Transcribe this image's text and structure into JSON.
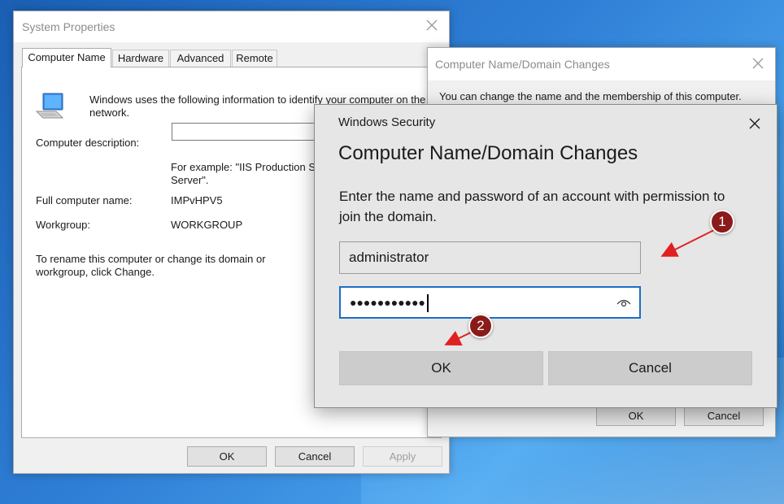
{
  "system_properties": {
    "title": "System Properties",
    "tabs": [
      "Computer Name",
      "Hardware",
      "Advanced",
      "Remote"
    ],
    "active_tab": "Computer Name",
    "intro": "Windows uses the following information to identify your computer on the network.",
    "description_label": "Computer description:",
    "description_value": "",
    "example_text": "For example: \"IIS Production S Server\".",
    "example_line1": "For example: \"IIS Production S",
    "example_line2": "Server\".",
    "full_name_label": "Full computer name:",
    "full_name_value": "IMPvHPV5",
    "workgroup_label": "Workgroup:",
    "workgroup_value": "WORKGROUP",
    "rename_text_line1": "To rename this computer or change its domain or",
    "rename_text_line2": "workgroup, click Change.",
    "buttons": {
      "ok": "OK",
      "cancel": "Cancel",
      "apply": "Apply"
    }
  },
  "domain_changes": {
    "title": "Computer Name/Domain Changes",
    "body_text": "You can change the name and the membership of this computer.",
    "buttons": {
      "ok": "OK",
      "cancel": "Cancel"
    }
  },
  "windows_security": {
    "caption": "Windows Security",
    "heading": "Computer Name/Domain Changes",
    "prompt_line1": "Enter the name and password of an account with permission to",
    "prompt_line2": "join the domain.",
    "username_value": "administrator",
    "password_masked": "●●●●●●●●●●●",
    "buttons": {
      "ok": "OK",
      "cancel": "Cancel"
    }
  },
  "annotations": {
    "badge1": "1",
    "badge2": "2",
    "color": "#8b1a1a",
    "arrow_color": "#e02020"
  },
  "icons": {
    "computer": "computer-icon",
    "close": "close-icon",
    "reveal": "eye-icon"
  }
}
